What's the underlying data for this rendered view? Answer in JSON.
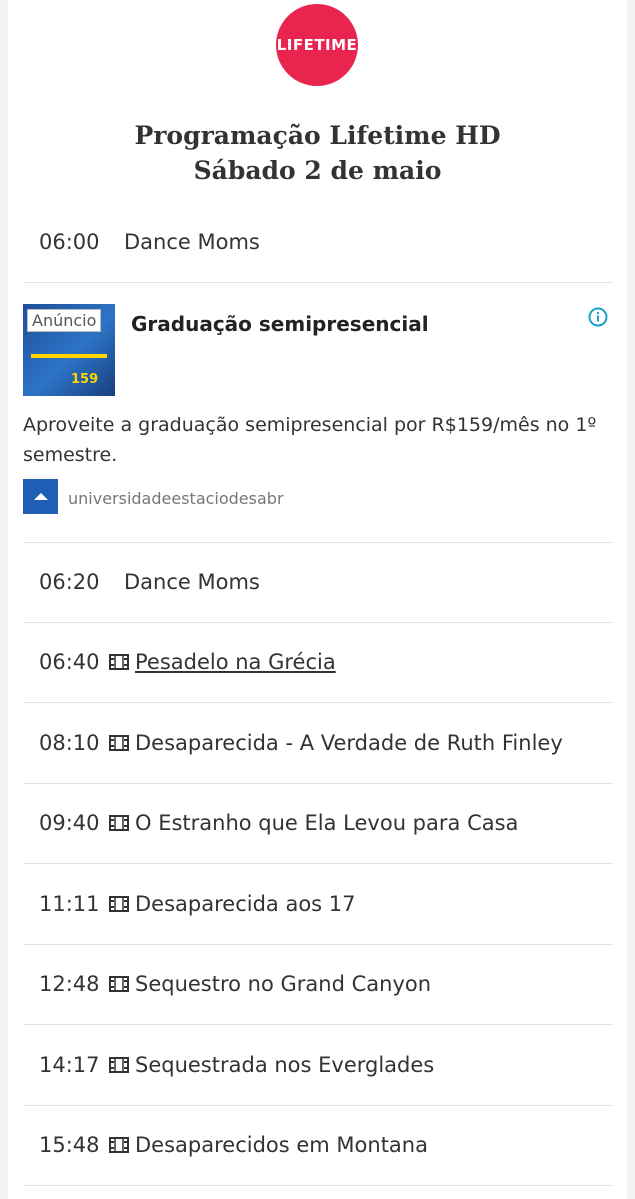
{
  "logo": {
    "text": "LIFETIME",
    "color": "#e8244f"
  },
  "header": {
    "title_line1": "Programação Lifetime HD",
    "title_line2": "Sábado 2 de maio"
  },
  "schedule_top": [
    {
      "time": "06:00",
      "title": "Dance Moms",
      "film": false
    }
  ],
  "ad": {
    "badge": "Anúncio",
    "title": "Graduação semipresencial",
    "description": "Aproveite a graduação semipresencial por R$159/mês no 1º semestre.",
    "source": "universidadeestaciodesabr",
    "thumb_price": "159",
    "info_icon": "info-icon"
  },
  "schedule": [
    {
      "time": "06:20",
      "title": "Dance Moms",
      "film": false,
      "link": false
    },
    {
      "time": "06:40",
      "title": " Pesadelo na Grécia",
      "film": true,
      "link": true
    },
    {
      "time": "08:10",
      "title": "Desaparecida - A Verdade de Ruth Finley",
      "film": true,
      "link": false
    },
    {
      "time": "09:40",
      "title": "O Estranho que Ela Levou para Casa",
      "film": true,
      "link": false
    },
    {
      "time": "11:11",
      "title": "Desaparecida aos 17",
      "film": true,
      "link": false
    },
    {
      "time": "12:48",
      "title": "Sequestro no Grand Canyon",
      "film": true,
      "link": false
    },
    {
      "time": "14:17",
      "title": "Sequestrada nos Everglades",
      "film": true,
      "link": false
    },
    {
      "time": "15:48",
      "title": "Desaparecidos em Montana",
      "film": true,
      "link": false
    }
  ],
  "icons": {
    "film": "film-icon",
    "info": "info-icon"
  },
  "colors": {
    "accent": "#e8244f",
    "info": "#1aa3c8"
  }
}
